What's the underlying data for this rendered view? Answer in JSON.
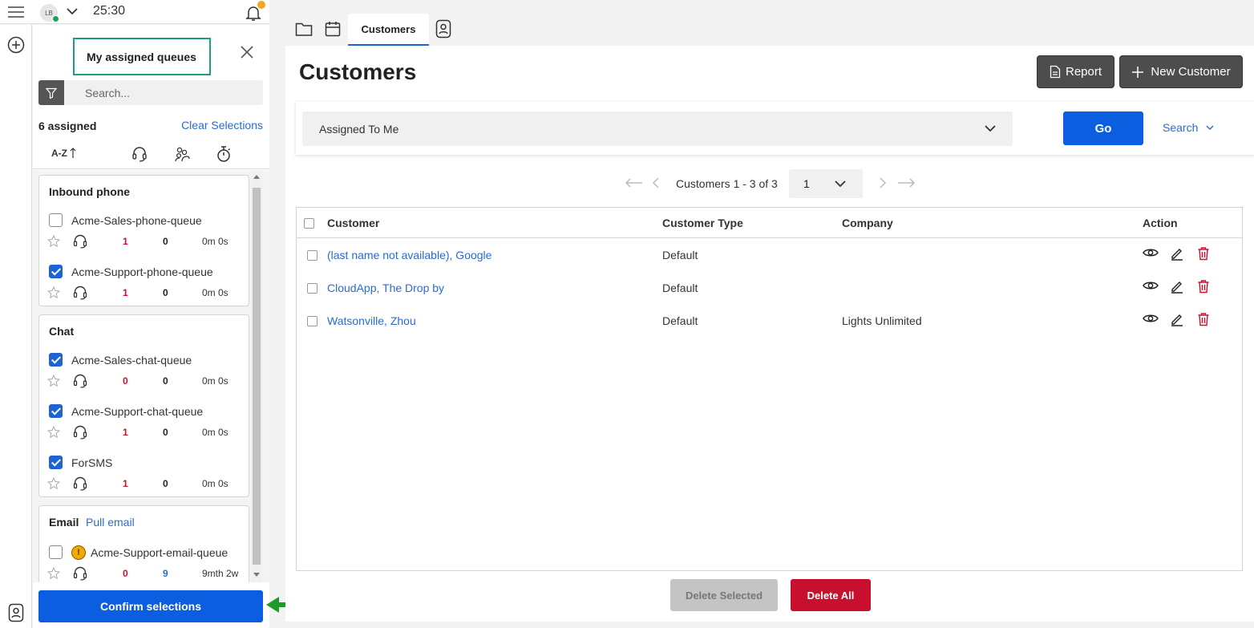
{
  "agent": {
    "avatar_initials": "LB",
    "timer": "25:30",
    "status_color": "#1aa35c",
    "notification_color": "#f5a623"
  },
  "panel": {
    "title": "My assigned queues",
    "search_placeholder": "Search...",
    "assigned_count": "6 assigned",
    "clear_label": "Clear Selections",
    "sort_label": "A-Z",
    "confirm_label": "Confirm selections",
    "groups": [
      {
        "title": "Inbound phone",
        "link": "",
        "items": [
          {
            "name": "Acme-Sales-phone-queue",
            "checked": false,
            "v1": "1",
            "v2": "0",
            "time": "0m 0s"
          },
          {
            "name": "Acme-Support-phone-queue",
            "checked": true,
            "v1": "1",
            "v2": "0",
            "time": "0m 0s"
          }
        ]
      },
      {
        "title": "Chat",
        "link": "",
        "items": [
          {
            "name": "Acme-Sales-chat-queue",
            "checked": true,
            "v1": "0",
            "v2": "0",
            "time": "0m 0s"
          },
          {
            "name": "Acme-Support-chat-queue",
            "checked": true,
            "v1": "1",
            "v2": "0",
            "time": "0m 0s"
          },
          {
            "name": "ForSMS",
            "checked": true,
            "v1": "1",
            "v2": "0",
            "time": "0m 0s"
          }
        ]
      },
      {
        "title": "Email",
        "link": "Pull email",
        "items": [
          {
            "name": "Acme-Support-email-queue",
            "checked": false,
            "warning": "!",
            "v1": "0",
            "v2": "9",
            "time": "9mth 2w"
          }
        ]
      }
    ]
  },
  "tabs": {
    "active_label": "Customers"
  },
  "main": {
    "title": "Customers",
    "report_label": "Report",
    "new_customer_label": "New Customer",
    "view_selected": "Assigned To Me",
    "go_label": "Go",
    "search_label": "Search",
    "pager_text": "Customers 1 - 3 of 3",
    "page_value": "1",
    "columns": [
      "Customer",
      "Customer Type",
      "Company",
      "Action"
    ],
    "rows": [
      {
        "customer": "(last name not available), Google",
        "type": "Default",
        "company": ""
      },
      {
        "customer": "CloudApp, The Drop by",
        "type": "Default",
        "company": ""
      },
      {
        "customer": "Watsonville, Zhou",
        "type": "Default",
        "company": "Lights Unlimited"
      }
    ],
    "delete_selected_label": "Delete Selected",
    "delete_all_label": "Delete All"
  },
  "colors": {
    "primary": "#0b5ee0",
    "danger": "#c8102e",
    "link": "#2a6bd1",
    "highlight_box": "#1d9d82",
    "arrow": "#1f9a2a"
  }
}
